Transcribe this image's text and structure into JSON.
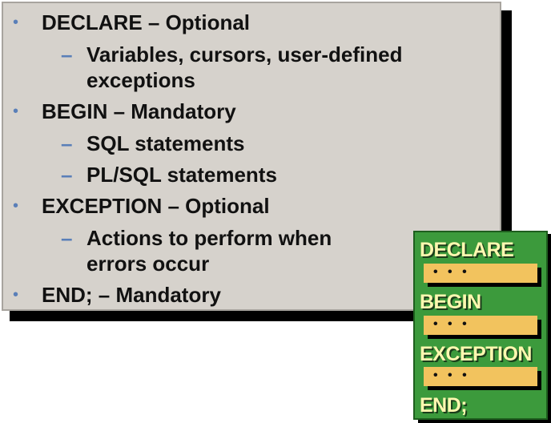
{
  "outline": {
    "items": [
      {
        "type": "bullet",
        "text": "DECLARE – Optional"
      },
      {
        "type": "sub",
        "text": "Variables, cursors, user-defined"
      },
      {
        "type": "cont",
        "text": "exceptions"
      },
      {
        "type": "bullet",
        "text": "BEGIN – Mandatory"
      },
      {
        "type": "sub",
        "text": "SQL statements"
      },
      {
        "type": "sub",
        "text": "PL/SQL statements"
      },
      {
        "type": "bullet",
        "text": "EXCEPTION – Optional"
      },
      {
        "type": "sub",
        "text": "Actions to perform when"
      },
      {
        "type": "cont",
        "text": "errors occur"
      },
      {
        "type": "bullet",
        "text": "END; – Mandatory"
      }
    ],
    "bullet_glyph": "•",
    "sub_glyph": "–"
  },
  "block_diagram": {
    "declare": "DECLARE",
    "begin": "BEGIN",
    "exception": "EXCEPTION",
    "end": "END;",
    "ellipsis": "• • •"
  },
  "colors": {
    "panel": "#d6d2cc",
    "bullet": "#5a7fb8",
    "block_green": "#3c9a3c",
    "keyword": "#fff8b0",
    "bar": "#f2c35e"
  }
}
